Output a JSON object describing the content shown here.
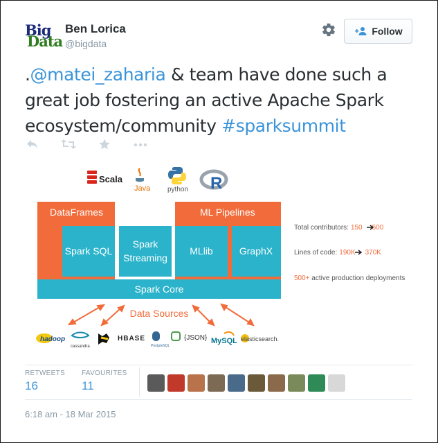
{
  "author": {
    "avatar_text_top": "Big",
    "avatar_text_bottom": "Data",
    "name": "Ben Lorica",
    "handle": "@bigdata"
  },
  "follow_label": "Follow",
  "tweet": {
    "prefix": ".",
    "mention": "@matei_zaharia",
    "text": " & team have done such a great job fostering an active Apache Spark ecosystem/community ",
    "hashtag": "#sparksummit"
  },
  "actions": [
    "reply-icon",
    "retweet-icon",
    "favorite-icon",
    "more-icon"
  ],
  "media": {
    "languages": {
      "scala": "Scala",
      "java": "Java",
      "python": "python",
      "r": "R"
    },
    "blocks": {
      "dataframes": "DataFrames",
      "ml_pipelines": "ML Pipelines",
      "spark_sql": "Spark SQL",
      "spark_streaming_line1": "Spark",
      "spark_streaming_line2": "Streaming",
      "mllib": "MLlib",
      "graphx": "GraphX",
      "spark_core": "Spark Core",
      "data_sources": "Data Sources"
    },
    "stats": {
      "contributors_label": "Total contributors:",
      "contributors_from": "150",
      "contributors_to": "500",
      "loc_label": "Lines of code:",
      "loc_from": "190K",
      "loc_to": "370K",
      "deployments_value": "500+",
      "deployments_label": " active production deployments"
    },
    "sources": {
      "hadoop": "hadoop",
      "cassandra": "cassandra",
      "hbase": "HBASE",
      "postgres": "PostgreSQL",
      "json": "{JSON}",
      "mysql": "MySQL",
      "elasticsearch": "elasticsearch."
    },
    "colors": {
      "orange": "#f26b3a",
      "teal": "#2bb3cb",
      "text_gray": "#555555"
    }
  },
  "stats": {
    "retweets_label": "RETWEETS",
    "retweets_value": "16",
    "favourites_label": "FAVOURITES",
    "favourites_value": "11"
  },
  "favouriters": [
    "#5a5a5a",
    "#c0392b",
    "#b8734a",
    "#7d6a55",
    "#4a6a8a",
    "#6b5a3a",
    "#8a6a4a",
    "#7a8a5a",
    "#2e8b57",
    "#d8d8d8"
  ],
  "timestamp": "6:18 am - 18 Mar 2015"
}
